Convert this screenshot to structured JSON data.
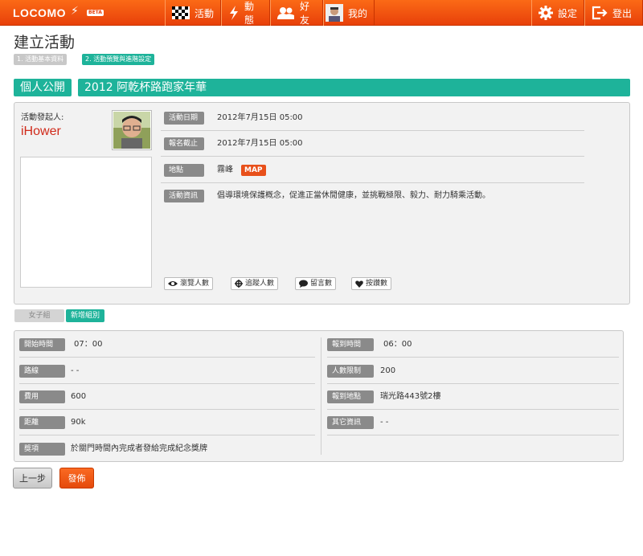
{
  "nav": {
    "logo": "LOCOMO",
    "beta": "BETA",
    "activities": "活動",
    "news": "動態",
    "friends": "好友",
    "mine": "我的",
    "settings": "設定",
    "logout": "登出"
  },
  "page": {
    "title": "建立活動",
    "step1": "1. 活動基本資料",
    "step2": "2. 活動預覽與進階設定"
  },
  "event": {
    "visibility": "個人公開",
    "name": "2012 阿乾杯路跑家年華",
    "organizer_label": "活動發起人:",
    "organizer": "iHower"
  },
  "info": [
    {
      "label": "活動日期",
      "value": "2012年7月15日 05:00"
    },
    {
      "label": "報名截止",
      "value": "2012年7月15日 05:00"
    },
    {
      "label": "地點",
      "value": "霧峰"
    },
    {
      "label": "活動資訊",
      "value": "倡導環境保護概念，促進正當休閒健康，並挑戰極限、毅力、耐力騎乘活動。"
    }
  ],
  "map_label": "MAP",
  "stats": {
    "views": "瀏覽人數",
    "follows": "追蹤人數",
    "comments": "留言數",
    "likes": "按讚數"
  },
  "groups": {
    "current": "女子組",
    "add": "新增組別"
  },
  "details_left": [
    {
      "label": "開始時間",
      "value": "07：00"
    },
    {
      "label": "路線",
      "value": "- -"
    },
    {
      "label": "費用",
      "value": "600"
    },
    {
      "label": "距離",
      "value": "90k"
    },
    {
      "label": "獎項",
      "value": "於關門時間內完成者發給完成紀念獎牌"
    }
  ],
  "details_right": [
    {
      "label": "報到時間",
      "value": "06：00"
    },
    {
      "label": "人數限制",
      "value": "200"
    },
    {
      "label": "報到地點",
      "value": "瑞光路443號2樓"
    },
    {
      "label": "其它資訊",
      "value": "- -"
    }
  ],
  "actions": {
    "prev": "上一步",
    "publish": "發佈"
  }
}
